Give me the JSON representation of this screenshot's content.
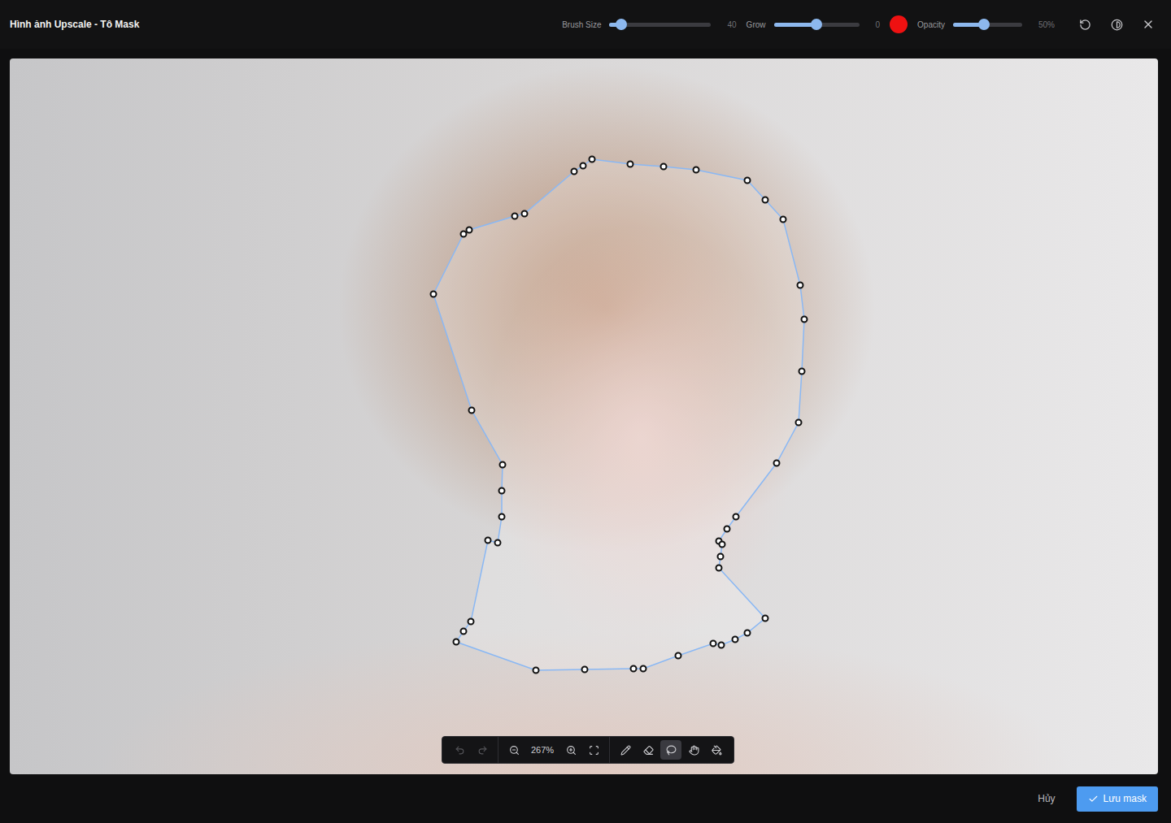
{
  "window": {
    "title": "Hình ảnh Upscale - Tô Mask"
  },
  "controls": {
    "brush_size": {
      "label": "Brush Size",
      "value": "40",
      "level": 0.12
    },
    "grow": {
      "label": "Grow",
      "value": "0",
      "level": 0.5
    },
    "brush_color": "#ee1111",
    "opacity": {
      "label": "Opacity",
      "value": "50%",
      "level": 0.45
    }
  },
  "toolbar": {
    "undo": {
      "disabled": true
    },
    "redo": {
      "disabled": true
    },
    "zoom": "267%",
    "tools": [
      {
        "selected": false
      },
      {
        "selected": false
      },
      {
        "selected": true
      },
      {
        "selected": false
      },
      {
        "selected": false
      }
    ]
  },
  "buttons": {
    "cancel": "Hủy",
    "save": "Lưu mask"
  }
}
